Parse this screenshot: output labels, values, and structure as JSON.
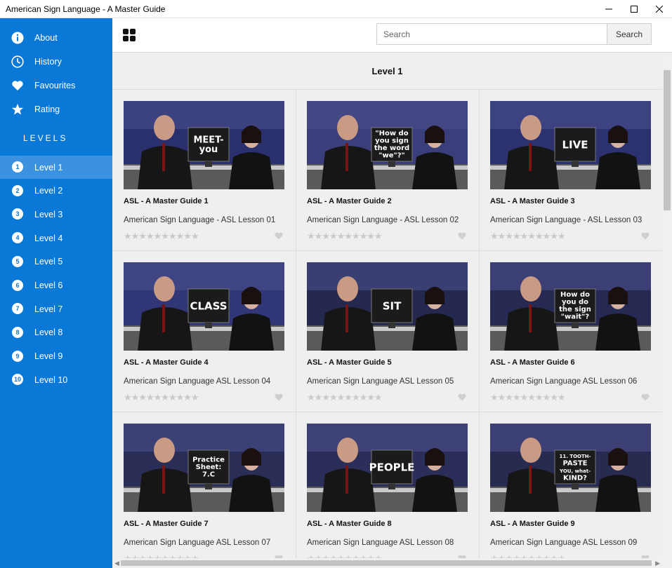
{
  "window": {
    "title": "American Sign Language - A Master Guide",
    "controls": [
      "minimize",
      "maximize",
      "close"
    ]
  },
  "sidebar": {
    "nav": [
      {
        "label": "About",
        "icon": "info-icon"
      },
      {
        "label": "History",
        "icon": "clock-icon"
      },
      {
        "label": "Favourites",
        "icon": "heart-icon"
      },
      {
        "label": "Rating",
        "icon": "star-icon"
      }
    ],
    "levels_header": "LEVELS",
    "levels": [
      {
        "num": "1",
        "label": "Level 1",
        "active": true
      },
      {
        "num": "2",
        "label": "Level 2"
      },
      {
        "num": "3",
        "label": "Level 3"
      },
      {
        "num": "4",
        "label": "Level 4"
      },
      {
        "num": "5",
        "label": "Level 5"
      },
      {
        "num": "6",
        "label": "Level 6"
      },
      {
        "num": "7",
        "label": "Level 7"
      },
      {
        "num": "8",
        "label": "Level 8"
      },
      {
        "num": "9",
        "label": "Level 9"
      },
      {
        "num": "10",
        "label": "Level 10"
      }
    ]
  },
  "toolbar": {
    "grid_icon": "grid-icon",
    "search_placeholder": "Search",
    "search_button": "Search"
  },
  "main": {
    "section_title": "Level 1",
    "cards": [
      {
        "title": "ASL - A Master Guide 1",
        "subtitle": "American Sign Language - ASL Lesson 01",
        "sign_text": "MEET-\nyou",
        "rating": 0
      },
      {
        "title": "ASL - A Master Guide 2",
        "subtitle": "American Sign Language - ASL Lesson 02",
        "sign_text": "\"How do\nyou sign\nthe word\n\"we\"?\"",
        "rating": 0
      },
      {
        "title": "ASL - A Master Guide 3",
        "subtitle": "American Sign Language - ASL Lesson 03",
        "sign_text": "LIVE",
        "rating": 0
      },
      {
        "title": "ASL - A Master Guide 4",
        "subtitle": "American Sign Language ASL Lesson 04",
        "sign_text": "CLASS",
        "rating": 0
      },
      {
        "title": "ASL - A Master Guide 5",
        "subtitle": "American Sign Language ASL Lesson 05",
        "sign_text": "SIT",
        "rating": 0
      },
      {
        "title": "ASL - A Master Guide 6",
        "subtitle": "American Sign Language ASL Lesson 06",
        "sign_text": "How do\nyou do\nthe sign\n\"wait\"?",
        "rating": 0
      },
      {
        "title": "ASL - A Master Guide 7",
        "subtitle": "American Sign Language ASL Lesson 07",
        "sign_text": "Practice\nSheet:\n7.C",
        "rating": 0
      },
      {
        "title": "ASL - A Master Guide 8",
        "subtitle": "American Sign Language ASL Lesson 08",
        "sign_text": "PEOPLE",
        "rating": 0
      },
      {
        "title": "ASL - A Master Guide 9",
        "subtitle": "American Sign Language ASL Lesson 09",
        "sign_text": "11. TOOTH-\nPASTE\nYOU, what-\nKIND?",
        "rating": 0
      }
    ]
  },
  "colors": {
    "sidebar_bg": "#0a78d7",
    "sidebar_active": "#3a92e0",
    "content_bg": "#efefef",
    "star_inactive": "#c9c9c9"
  }
}
